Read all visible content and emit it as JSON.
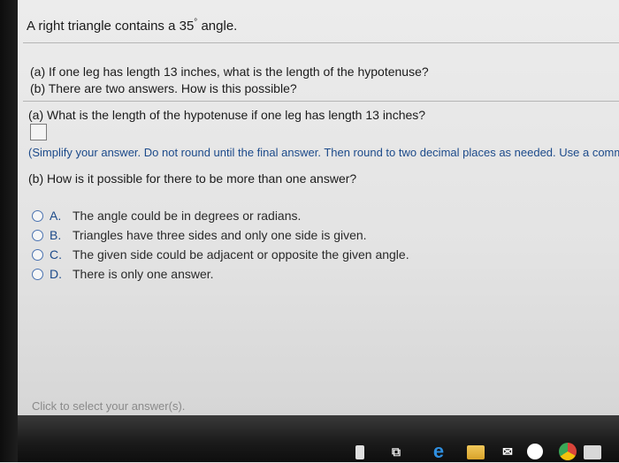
{
  "question": {
    "title_prefix": "A right triangle contains a 35",
    "title_degree": "°",
    "title_suffix": " angle.",
    "part_a_intro": "(a) If one leg has length 13 inches, what is the length of the hypotenuse?",
    "part_b_intro": "(b) There are two answers. How is this possible?"
  },
  "part_a": {
    "question": "(a) What is the length of the hypotenuse if one leg has length 13 inches?",
    "answer_value": "",
    "hint": "(Simplify your answer. Do not round until the final answer. Then round to two decimal places as needed. Use a comma"
  },
  "part_b": {
    "question": "(b) How is it possible for there to be more than one answer?",
    "options": [
      {
        "letter": "A.",
        "text": "The angle could be in degrees or radians."
      },
      {
        "letter": "B.",
        "text": "Triangles have three sides and only one side is given."
      },
      {
        "letter": "C.",
        "text": "The given side could be adjacent or opposite the given angle."
      },
      {
        "letter": "D.",
        "text": "There is only one answer."
      }
    ]
  },
  "footer": {
    "select_hint": "Click to select your answer(s)."
  },
  "taskbar": {
    "icons": [
      "store-icon",
      "task-view-icon",
      "edge-icon",
      "file-explorer-icon",
      "mail-icon",
      "media-icon",
      "chrome-icon",
      "photos-icon"
    ]
  }
}
